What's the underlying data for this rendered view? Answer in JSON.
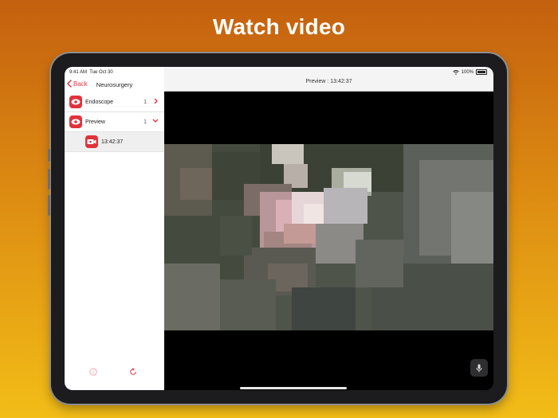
{
  "headline": "Watch video",
  "status": {
    "time": "9:41 AM",
    "date": "Tue Oct 30",
    "battery": "100%"
  },
  "sidebar": {
    "back_label": "Back",
    "title": "Neurosurgery",
    "items": [
      {
        "label": "Endoscope",
        "count": "1",
        "expanded": false
      },
      {
        "label": "Preview",
        "count": "1",
        "expanded": true
      },
      {
        "label": "13:42:37",
        "sub": true
      }
    ]
  },
  "main": {
    "title": "Preview : 13:42:37"
  },
  "colors": {
    "accent": "#e1323c",
    "sidebar_bg": "#ffffff",
    "selected_row": "#efefef"
  },
  "icons": [
    "back-chevron-icon",
    "eye-icon",
    "chevron-right-icon",
    "chevron-down-icon",
    "video-camera-icon",
    "info-icon",
    "refresh-icon",
    "microphone-icon",
    "wifi-icon",
    "battery-icon"
  ]
}
